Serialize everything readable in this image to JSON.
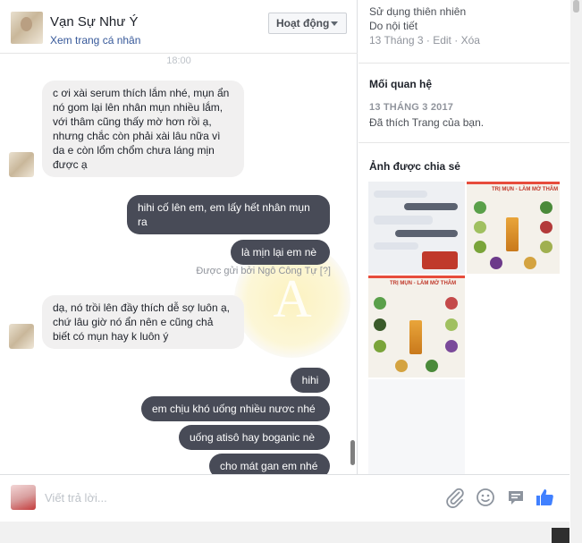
{
  "header": {
    "name": "Vạn Sự Như Ý",
    "profile_link": "Xem trang cá nhân",
    "status": "Hoạt động"
  },
  "conversation": {
    "timestamp": "18:00",
    "sent_by_label": "Được gửi bởi Ngô Công Tự [?]",
    "watermark_letter": "A",
    "messages": [
      {
        "from": "them",
        "text": "c ơi xài serum thích lắm nhé, mụn ẩn nó gom lại lên nhân mụn nhiều lắm, với thâm cũng thấy mờ hơn rồi ạ, nhưng chắc còn phải xài lâu nữa vì da e còn lổm chổm chưa láng mịn được ạ"
      },
      {
        "from": "me",
        "text": "hihi cố lên em, em lấy hết nhân mụn ra"
      },
      {
        "from": "me",
        "text": "là mịn lại em nè"
      },
      {
        "from": "them",
        "text": "dạ, nó trồi lên đầy thích dễ sợ luôn ạ, chứ lâu giờ nó ẩn nên e cũng chả biết có mụn hay k luôn ý"
      },
      {
        "from": "me",
        "text": "hihi"
      },
      {
        "from": "me",
        "text": "em chịu khó uống nhiều nươc nhé"
      },
      {
        "from": "me",
        "text": "uống atisô hay boganic nè"
      },
      {
        "from": "me",
        "text": "cho mát gan em nhé"
      }
    ]
  },
  "composer": {
    "placeholder": "Viết trả lời...",
    "icons": [
      "paperclip-icon",
      "emoji-icon",
      "sticker-icon",
      "thumbs-up-icon"
    ],
    "accent_color": "#4080ff"
  },
  "info": {
    "lines_top": [
      "Sử dụng thiên nhiên",
      "Do nội tiết"
    ],
    "note_date": "13 Tháng 3",
    "edit_label": "Edit",
    "delete_label": "Xóa",
    "relationship": {
      "title": "Mối quan hệ",
      "date": "13 THÁNG 3 2017",
      "text": "Đã thích Trang của bạn."
    },
    "photos": {
      "title": "Ảnh được chia sẻ",
      "caption": "TRỊ MỤN - LÀM MỜ THÂM"
    }
  },
  "colors": {
    "outgoing_bubble": "#484b57",
    "incoming_bubble": "#f1f0f0",
    "link": "#365899"
  }
}
